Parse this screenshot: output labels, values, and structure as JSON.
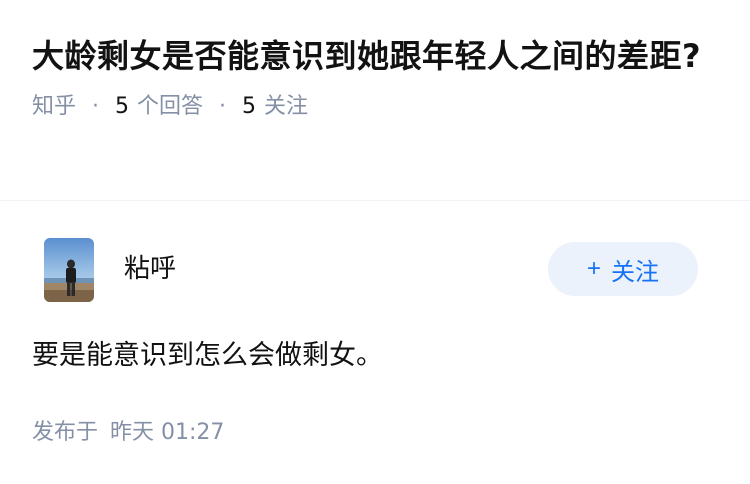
{
  "question": {
    "title": "大龄剩女是否能意识到她跟年轻人之间的差距?",
    "source": "知乎",
    "answers_count": "5",
    "answers_label": "个回答",
    "follows_count": "5",
    "follows_label": "关注"
  },
  "answer": {
    "author_name": "粘呼",
    "follow_label": "关注",
    "follow_icon": "plus-icon",
    "content": "要是能意识到怎么会做剩女。",
    "published_prefix": "发布于",
    "published_time": "昨天 01:27"
  },
  "colors": {
    "meta_gray": "#8590a6",
    "follow_blue": "#1772f6",
    "follow_bg": "#ebf2fb"
  }
}
